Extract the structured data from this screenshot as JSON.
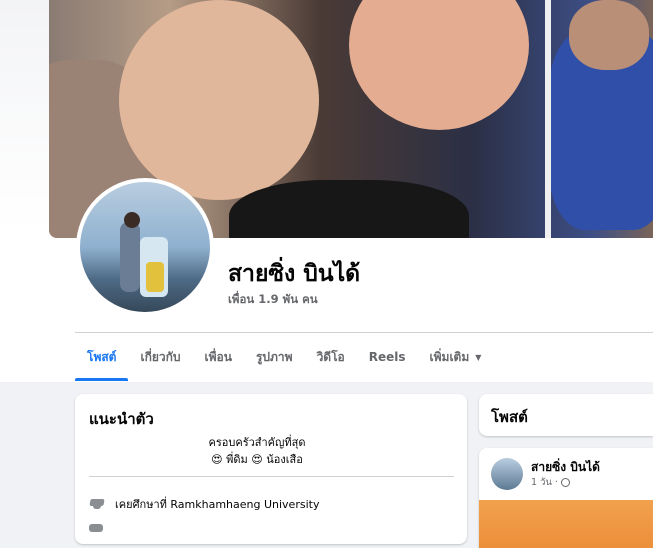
{
  "profile": {
    "name": "สายซิ่ง บินได้",
    "friends": "เพื่อน 1.9 พัน คน"
  },
  "tabs": [
    {
      "label": "โพสต์",
      "active": true
    },
    {
      "label": "เกี่ยวกับ",
      "active": false
    },
    {
      "label": "เพื่อน",
      "active": false
    },
    {
      "label": "รูปภาพ",
      "active": false
    },
    {
      "label": "วิดีโอ",
      "active": false
    },
    {
      "label": "Reels",
      "active": false
    },
    {
      "label": "เพิ่มเติม",
      "active": false
    }
  ],
  "intro": {
    "title": "แนะนำตัว",
    "bio_line1": "ครอบครัวสำคัญที่สุด",
    "bio_line2": "😍 พี่ดิม 😍 น้องเสือ",
    "education": "เคยศึกษาที่ Ramkhamhaeng University"
  },
  "posts": {
    "title": "โพสต์",
    "item": {
      "author": "สายซิ่ง บินได้",
      "time": "1 วัน ·"
    }
  },
  "colors": {
    "accent": "#1877f2",
    "muted_text": "#65676b",
    "page_bg": "#f0f2f5"
  },
  "icons": [
    "graduation-cap-icon",
    "globe-icon",
    "caret-down-icon"
  ]
}
